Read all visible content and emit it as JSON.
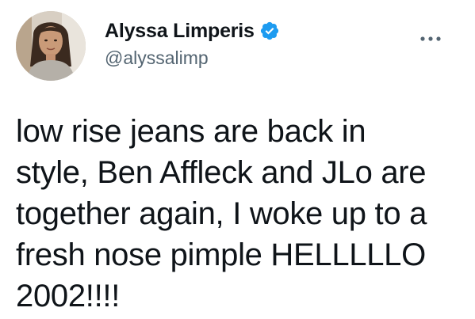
{
  "tweet": {
    "author": {
      "display_name": "Alyssa Limperis",
      "handle": "@alyssalimp",
      "verified": true
    },
    "text_lines": [
      "low rise jeans are back in",
      "style, Ben Affleck and JLo are",
      "together again, I woke up to a",
      "fresh nose pimple HELLLLLO",
      "2002!!!!"
    ],
    "icons": {
      "verified": "verified-badge-icon",
      "more": "more-options-icon"
    },
    "colors": {
      "text": "#0f1419",
      "secondary": "#536471",
      "verified": "#1d9bf0"
    }
  }
}
